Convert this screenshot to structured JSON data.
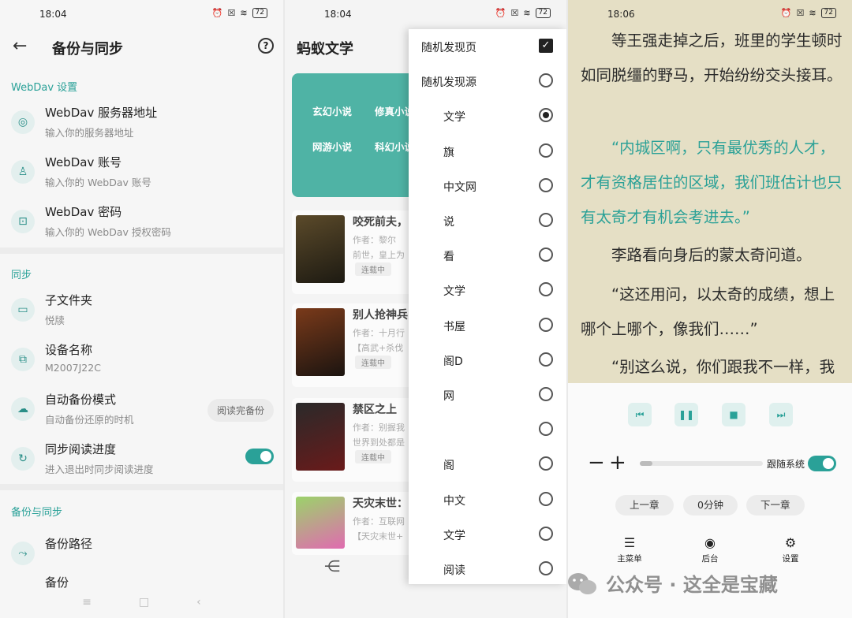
{
  "panel1": {
    "time": "18:04",
    "battery": "72",
    "title": "备份与同步",
    "help": "?",
    "sections": {
      "webdav": "WebDav 设置",
      "sync": "同步",
      "backup": "备份与同步"
    },
    "rows": {
      "server": {
        "title": "WebDav 服务器地址",
        "sub": "输入你的服务器地址"
      },
      "account": {
        "title": "WebDav 账号",
        "sub": "输入你的 WebDav 账号"
      },
      "password": {
        "title": "WebDav 密码",
        "sub": "输入你的 WebDav 授权密码"
      },
      "subfolder": {
        "title": "子文件夹",
        "sub": "悦牍"
      },
      "device": {
        "title": "设备名称",
        "sub": "M2007J22C"
      },
      "autobackup": {
        "title": "自动备份模式",
        "sub": "自动备份还原的时机",
        "button": "阅读完备份"
      },
      "syncprogress": {
        "title": "同步阅读进度",
        "sub": "进入退出时同步阅读进度"
      },
      "backuppath": {
        "title": "备份路径"
      },
      "backup": {
        "title": "备份"
      }
    }
  },
  "panel2": {
    "time": "18:04",
    "battery": "72",
    "app_title": "蚂蚁文学",
    "banner": [
      "玄幻小说",
      "修真小说",
      "网游小说",
      "科幻小说"
    ],
    "books": [
      {
        "title": "咬死前夫，",
        "author": "作者：黎尔",
        "desc": "前世，皇上为",
        "tag": "连载中"
      },
      {
        "title": "别人抢神兵",
        "author": "作者：十月行",
        "desc": "【高武+杀伐",
        "tag": "连载中"
      },
      {
        "title": "禁区之上",
        "author": "作者：别握我",
        "desc": "世界到处都是",
        "tag": "连载中"
      },
      {
        "title": "天灾末世：",
        "author": "作者：互联网",
        "desc": "【天灾末世+",
        "tag": ""
      }
    ],
    "menu": [
      {
        "label": "随机发现页",
        "type": "check"
      },
      {
        "label": "随机发现源",
        "type": "radio"
      },
      {
        "label": "文学",
        "type": "radio-on"
      },
      {
        "label": "旗",
        "type": "radio"
      },
      {
        "label": "中文网",
        "type": "radio"
      },
      {
        "label": "说",
        "type": "radio"
      },
      {
        "label": "看",
        "type": "radio"
      },
      {
        "label": "文学",
        "type": "radio"
      },
      {
        "label": "书屋",
        "type": "radio"
      },
      {
        "label": "阁D",
        "type": "radio"
      },
      {
        "label": "网",
        "type": "radio"
      },
      {
        "label": "",
        "type": "radio"
      },
      {
        "label": "阁",
        "type": "radio"
      },
      {
        "label": "中文",
        "type": "radio"
      },
      {
        "label": "文学",
        "type": "radio"
      },
      {
        "label": "阅读",
        "type": "radio"
      }
    ]
  },
  "panel3": {
    "time": "18:06",
    "battery": "72",
    "paragraphs": [
      "等王强走掉之后，班里的学生顿时如同脱缰的野马，开始纷纷交头接耳。",
      "“内城区啊，只有最优秀的人才，才有资格居住的区域，我们班估计也只有太奇才有机会考进去。”",
      "李路看向身后的蒙太奇问道。",
      "“这还用问，以太奇的成绩，想上哪个上哪个，像我们……”",
      "“别这么说，你们跟我不一样，我"
    ],
    "follow_system": "跟随系统",
    "chips": {
      "prev": "上一章",
      "timer": "0分钟",
      "next": "下一章"
    },
    "bottom": {
      "menu": "主菜单",
      "background": "后台",
      "settings": "设置"
    },
    "speed_progress": 0.1
  },
  "watermark": "公众号 · 这全是宝藏",
  "colors": {
    "accent": "#2aa198",
    "reader_bg": "#e5dfc5",
    "banner": "#4fb3a5"
  }
}
